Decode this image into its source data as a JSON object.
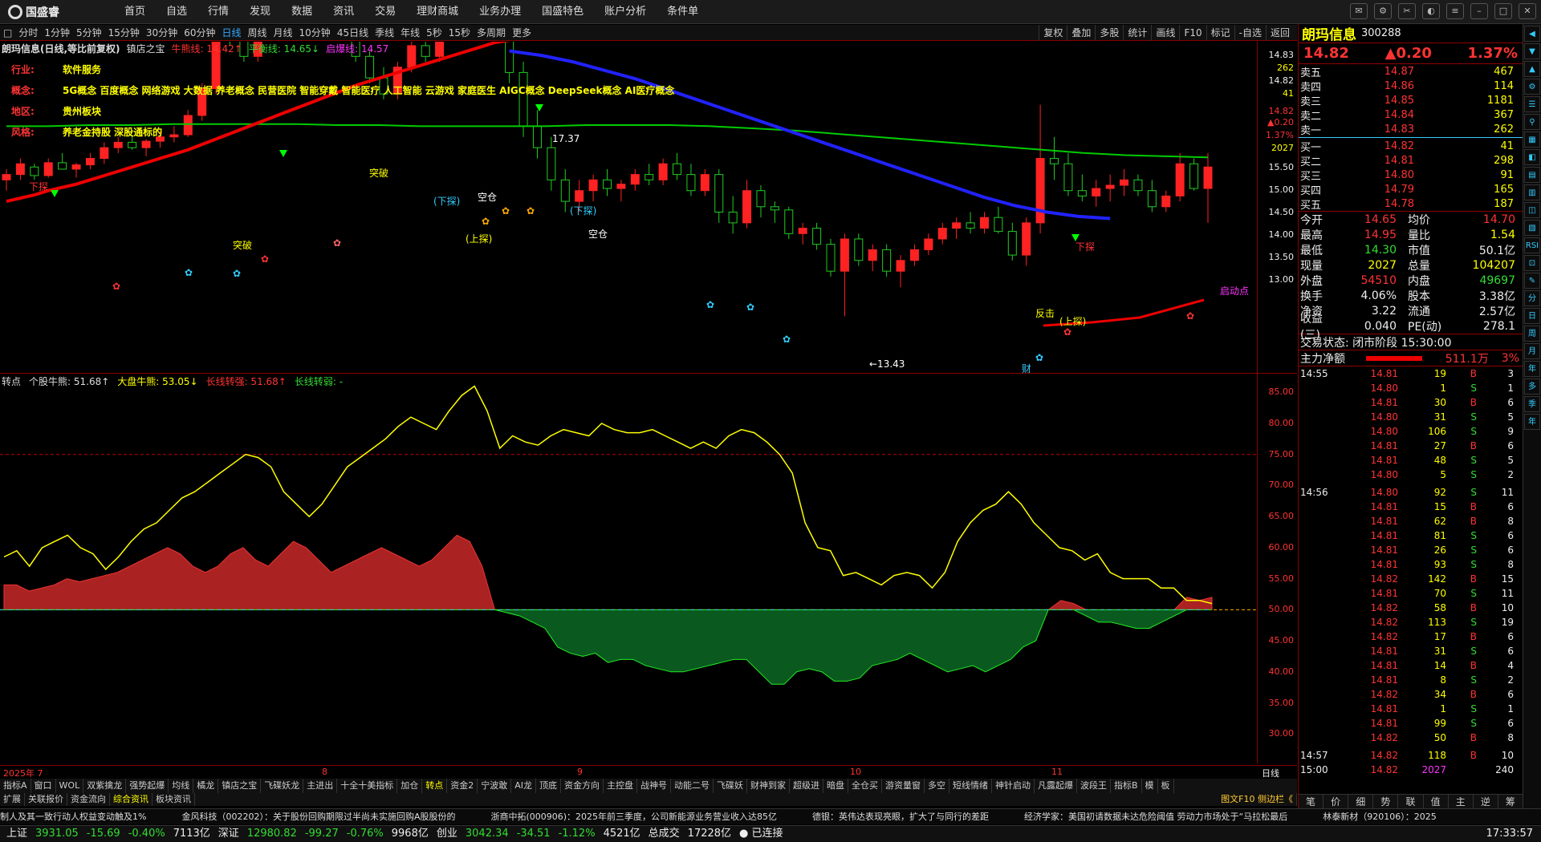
{
  "app": {
    "name": "国盛睿"
  },
  "menu": [
    "首页",
    "自选",
    "行情",
    "发现",
    "数据",
    "资讯",
    "交易",
    "理财商城",
    "业务办理",
    "国盛特色",
    "账户分析",
    "条件单"
  ],
  "periods": [
    "分时",
    "1分钟",
    "5分钟",
    "15分钟",
    "30分钟",
    "60分钟",
    "日线",
    "周线",
    "月线",
    "10分钟",
    "45日线",
    "季线",
    "年线",
    "5秒",
    "15秒",
    "多周期",
    "更多"
  ],
  "active_period": "日线",
  "chart_tools": [
    "复权",
    "叠加",
    "多股",
    "统计",
    "画线",
    "F10",
    "标记",
    "-自选",
    "返回"
  ],
  "chart_title": {
    "name": "朗玛信息(日线,等比前复权)",
    "indicator": "镇店之宝",
    "niu": "牛熊线: 14.42↑",
    "ping": "平衡线: 14.65↓",
    "qi": "启爆线: 14.57"
  },
  "stock_info": [
    {
      "label": "行业:",
      "value": "软件服务"
    },
    {
      "label": "概念:",
      "value": "5G概念 百度概念 网络游戏 大数据 养老概念 民营医院 智能穿戴 智能医疗 人工智能 云游戏 家庭医生 AIGC概念 DeepSeek概念 AI医疗概念"
    },
    {
      "label": "地区:",
      "value": "贵州板块"
    },
    {
      "label": "风格:",
      "value": "养老金持股 深股通标的"
    }
  ],
  "main_annotations": {
    "xiatan": "下探",
    "shangtan": "(上探)",
    "xiatan2": "(下探)",
    "kongcang": "空仓",
    "tupo": "突破",
    "qidong": "启动点",
    "qidian": "起涨",
    "peak": "17.37",
    "low": "←13.43",
    "cai": "财",
    "sub_peak": "下探",
    "fx": "反击"
  },
  "price_axis": [
    "14.83",
    "262",
    "14.82",
    "41",
    "14.82",
    "▲0.20",
    "1.37%",
    "2027",
    "15.50",
    "15.00",
    "14.50",
    "14.00",
    "13.50",
    "13.00"
  ],
  "sub_title": {
    "name": "转点",
    "a": "个股牛熊: 51.68↑",
    "b": "大盘牛熊: 53.05↓",
    "c": "长线转强: 51.68↑",
    "d": "长线转弱: -"
  },
  "sub_axis": [
    "85.00",
    "80.00",
    "75.00",
    "70.00",
    "65.00",
    "60.00",
    "55.00",
    "50.00",
    "45.00",
    "40.00",
    "35.00",
    "30.00"
  ],
  "dates": [
    "2025年 7",
    "8",
    "9",
    "10",
    "11"
  ],
  "day_label": "日线",
  "tabs1": [
    "指标A",
    "窗口",
    "WOL",
    "双紫擒龙",
    "强势起爆",
    "均线",
    "橘龙",
    "镇店之宝",
    "飞碟妖龙",
    "主进出",
    "十全十美指标",
    "加仓",
    "转点",
    "资金2",
    "宁波敢",
    "AI龙",
    "顶底",
    "资金方向",
    "主控盘",
    "战神号",
    "动能二号",
    "飞碟妖",
    "财神到家",
    "超级进",
    "暗盘",
    "全仓买",
    "游资量窗",
    "多空",
    "短线情绪",
    "神针启动",
    "凡露起爆",
    "波段王",
    "指标B",
    "模",
    "板"
  ],
  "tabs1_active": "转点",
  "tabs2": [
    "扩展",
    "关联报价",
    "资金流向",
    "综合资讯",
    "板块资讯"
  ],
  "tabs2_right": "图文F10 侧边栏《",
  "news": [
    "制人及其一致行动人权益变动触及1%",
    "金风科技（002202）：关于股份回购期限过半尚未实施回购A股股份的",
    "浙商中拓(000906)：2025年前三季度，公司新能源业务营业收入达85亿",
    "德银：英伟达表现亮眼，扩大了与同行的差距",
    "经济学家：美国初请数据未达危险阈值 劳动力市场处于“马拉松最后",
    "林泰新材（920106）：2025"
  ],
  "status": {
    "sh_label": "上证",
    "sh": "3931.05",
    "sh_chg": "-15.69",
    "sh_pct": "-0.40%",
    "sh_amt": "7113亿",
    "sz_label": "深证",
    "sz": "12980.82",
    "sz_chg": "-99.27",
    "sz_pct": "-0.76%",
    "sz_amt": "9968亿",
    "cy_label": "创业",
    "cy": "3042.34",
    "cy_chg": "-34.51",
    "cy_pct": "-1.12%",
    "cy_amt": "4521亿",
    "total_label": "总成交",
    "total": "17228亿",
    "conn": "已连接",
    "time": "17:33:57"
  },
  "quote": {
    "name": "朗玛信息",
    "code": "300288",
    "price": "14.82",
    "change": "▲0.20",
    "pct": "1.37%",
    "asks": [
      [
        "卖五",
        "14.87",
        "467"
      ],
      [
        "卖四",
        "14.86",
        "114"
      ],
      [
        "卖三",
        "14.85",
        "1181"
      ],
      [
        "卖二",
        "14.84",
        "367"
      ],
      [
        "卖一",
        "14.83",
        "262"
      ]
    ],
    "bids": [
      [
        "买一",
        "14.82",
        "41"
      ],
      [
        "买二",
        "14.81",
        "298"
      ],
      [
        "买三",
        "14.80",
        "91"
      ],
      [
        "买四",
        "14.79",
        "165"
      ],
      [
        "买五",
        "14.78",
        "187"
      ]
    ],
    "stats": [
      [
        "今开",
        "14.65",
        "均价",
        "14.70"
      ],
      [
        "最高",
        "14.95",
        "量比",
        "1.54"
      ],
      [
        "最低",
        "14.30",
        "市值",
        "50.1亿"
      ],
      [
        "现量",
        "2027",
        "总量",
        "104207"
      ],
      [
        "外盘",
        "54510",
        "内盘",
        "49697"
      ],
      [
        "换手",
        "4.06%",
        "股本",
        "3.38亿"
      ],
      [
        "净资",
        "3.22",
        "流通",
        "2.57亿"
      ],
      [
        "收益(三)",
        "0.040",
        "PE(动)",
        "278.1"
      ]
    ],
    "trade_status": "交易状态: 闭市阶段 15:30:00",
    "net_label": "主力净额",
    "net": "511.1万",
    "net_pct": "3%",
    "ticks": [
      [
        "14:55",
        "14.81",
        "19",
        "B",
        "3"
      ],
      [
        "",
        "14.80",
        "1",
        "S",
        "1"
      ],
      [
        "",
        "14.81",
        "30",
        "B",
        "6"
      ],
      [
        "",
        "14.80",
        "31",
        "S",
        "5"
      ],
      [
        "",
        "14.80",
        "106",
        "S",
        "9"
      ],
      [
        "",
        "14.81",
        "27",
        "B",
        "6"
      ],
      [
        "",
        "14.81",
        "48",
        "S",
        "5"
      ],
      [
        "",
        "14.80",
        "5",
        "S",
        "2"
      ],
      [
        "14:56",
        "14.80",
        "92",
        "S",
        "11"
      ],
      [
        "",
        "14.81",
        "15",
        "B",
        "6"
      ],
      [
        "",
        "14.81",
        "62",
        "B",
        "8"
      ],
      [
        "",
        "14.81",
        "81",
        "S",
        "6"
      ],
      [
        "",
        "14.81",
        "26",
        "S",
        "6"
      ],
      [
        "",
        "14.81",
        "93",
        "S",
        "8"
      ],
      [
        "",
        "14.82",
        "142",
        "B",
        "15"
      ],
      [
        "",
        "14.81",
        "70",
        "S",
        "11"
      ],
      [
        "",
        "14.82",
        "58",
        "B",
        "10"
      ],
      [
        "",
        "14.82",
        "113",
        "S",
        "19"
      ],
      [
        "",
        "14.82",
        "17",
        "B",
        "6"
      ],
      [
        "",
        "14.81",
        "31",
        "S",
        "6"
      ],
      [
        "",
        "14.81",
        "14",
        "B",
        "4"
      ],
      [
        "",
        "14.81",
        "8",
        "S",
        "2"
      ],
      [
        "",
        "14.82",
        "34",
        "B",
        "6"
      ],
      [
        "",
        "14.81",
        "1",
        "S",
        "1"
      ],
      [
        "",
        "14.81",
        "99",
        "S",
        "6"
      ],
      [
        "",
        "14.82",
        "50",
        "B",
        "8"
      ],
      [
        "14:57",
        "14.82",
        "118",
        "B",
        "10"
      ],
      [
        "15:00",
        "14.82",
        "2027",
        "",
        "240"
      ]
    ],
    "bottom_tabs": [
      "笔",
      "价",
      "细",
      "势",
      "联",
      "值",
      "主",
      "逆",
      "筹"
    ]
  },
  "vtabs": [
    "◀",
    "▼",
    "▲",
    "⚙",
    "☰",
    "⚲",
    "▦",
    "◧",
    "▤",
    "▥",
    "◫",
    "▧",
    "RSI",
    "⊡",
    "✎",
    "分",
    "日",
    "周",
    "月",
    "年",
    "多",
    "季",
    "年"
  ],
  "chart_data": {
    "type": "line",
    "title": "朗玛信息(日线,等比前复权)",
    "ylim_main": [
      13.0,
      15.8
    ],
    "candles": [
      [
        14.7,
        14.8,
        14.6,
        14.75
      ],
      [
        14.75,
        14.9,
        14.7,
        14.85
      ],
      [
        14.82,
        14.85,
        14.7,
        14.74
      ],
      [
        14.74,
        14.9,
        14.72,
        14.86
      ],
      [
        14.86,
        14.95,
        14.8,
        14.8
      ],
      [
        14.8,
        14.86,
        14.72,
        14.84
      ],
      [
        14.84,
        14.95,
        14.8,
        14.9
      ],
      [
        14.9,
        15.05,
        14.85,
        15.0
      ],
      [
        15.0,
        15.1,
        14.95,
        15.05
      ],
      [
        15.05,
        15.12,
        14.98,
        15.0
      ],
      [
        15.0,
        15.08,
        14.92,
        15.06
      ],
      [
        15.06,
        15.15,
        15.0,
        15.1
      ],
      [
        15.1,
        15.2,
        15.05,
        15.12
      ],
      [
        15.12,
        15.35,
        15.1,
        15.3
      ],
      [
        15.3,
        15.6,
        15.25,
        15.55
      ],
      [
        15.55,
        16.3,
        15.5,
        16.2
      ],
      [
        16.2,
        16.3,
        15.95,
        16.0
      ],
      [
        16.0,
        16.05,
        15.8,
        15.85
      ],
      [
        15.85,
        16.1,
        15.8,
        16.05
      ],
      [
        16.05,
        16.4,
        16.0,
        16.3
      ],
      [
        16.3,
        16.5,
        16.2,
        16.4
      ],
      [
        16.4,
        16.55,
        16.3,
        16.35
      ],
      [
        16.35,
        16.6,
        16.3,
        16.5
      ],
      [
        16.5,
        16.55,
        16.2,
        16.25
      ],
      [
        16.25,
        16.3,
        16.0,
        16.1
      ],
      [
        16.1,
        16.2,
        15.8,
        15.85
      ],
      [
        15.85,
        15.9,
        15.6,
        15.65
      ],
      [
        15.65,
        15.75,
        15.45,
        15.5
      ],
      [
        15.5,
        15.8,
        15.45,
        15.75
      ],
      [
        15.75,
        16.0,
        15.7,
        15.95
      ],
      [
        15.95,
        16.1,
        15.8,
        15.85
      ],
      [
        15.85,
        16.2,
        15.8,
        16.1
      ],
      [
        16.1,
        16.3,
        16.0,
        16.25
      ],
      [
        16.25,
        16.6,
        16.2,
        16.5
      ],
      [
        16.5,
        17.37,
        16.45,
        17.2
      ],
      [
        17.2,
        17.3,
        16.4,
        16.5
      ],
      [
        16.5,
        16.55,
        15.6,
        15.7
      ],
      [
        15.7,
        15.8,
        15.1,
        15.2
      ],
      [
        15.2,
        15.35,
        14.9,
        15.0
      ],
      [
        15.0,
        15.1,
        14.6,
        14.7
      ],
      [
        14.7,
        14.8,
        14.4,
        14.5
      ],
      [
        14.5,
        14.7,
        14.4,
        14.6
      ],
      [
        14.6,
        14.75,
        14.5,
        14.7
      ],
      [
        14.7,
        14.8,
        14.55,
        14.62
      ],
      [
        14.62,
        14.7,
        14.5,
        14.66
      ],
      [
        14.66,
        14.8,
        14.6,
        14.75
      ],
      [
        14.75,
        14.85,
        14.65,
        14.7
      ],
      [
        14.7,
        14.9,
        14.65,
        14.85
      ],
      [
        14.85,
        14.95,
        14.7,
        14.75
      ],
      [
        14.75,
        14.85,
        14.55,
        14.6
      ],
      [
        14.6,
        14.8,
        14.55,
        14.75
      ],
      [
        14.75,
        14.8,
        14.3,
        14.4
      ],
      [
        14.4,
        14.55,
        14.2,
        14.3
      ],
      [
        14.3,
        14.7,
        14.25,
        14.6
      ],
      [
        14.6,
        14.65,
        14.35,
        14.45
      ],
      [
        14.45,
        14.5,
        14.3,
        14.42
      ],
      [
        14.42,
        14.45,
        14.15,
        14.2
      ],
      [
        14.2,
        14.3,
        14.1,
        14.25
      ],
      [
        14.25,
        14.3,
        14.05,
        14.1
      ],
      [
        14.1,
        14.15,
        13.8,
        13.85
      ],
      [
        13.85,
        14.2,
        13.43,
        14.15
      ],
      [
        14.15,
        14.2,
        13.9,
        13.95
      ],
      [
        13.95,
        14.1,
        13.85,
        14.05
      ],
      [
        14.05,
        14.1,
        13.8,
        13.85
      ],
      [
        13.85,
        14.0,
        13.7,
        13.95
      ],
      [
        13.95,
        14.1,
        13.9,
        14.05
      ],
      [
        14.05,
        14.2,
        14.0,
        14.15
      ],
      [
        14.15,
        14.3,
        14.1,
        14.25
      ],
      [
        14.25,
        14.35,
        14.15,
        14.3
      ],
      [
        14.3,
        14.4,
        14.2,
        14.25
      ],
      [
        14.25,
        14.4,
        14.2,
        14.35
      ],
      [
        14.35,
        14.45,
        14.2,
        14.22
      ],
      [
        14.22,
        14.3,
        13.95,
        14.0
      ],
      [
        14.0,
        14.35,
        13.9,
        14.3
      ],
      [
        14.3,
        15.4,
        14.2,
        14.9
      ],
      [
        14.9,
        15.1,
        14.7,
        14.85
      ],
      [
        14.85,
        14.95,
        14.55,
        14.6
      ],
      [
        14.6,
        14.75,
        14.5,
        14.55
      ],
      [
        14.55,
        14.7,
        14.45,
        14.62
      ],
      [
        14.62,
        14.75,
        14.5,
        14.65
      ],
      [
        14.65,
        14.8,
        14.55,
        14.7
      ],
      [
        14.7,
        14.75,
        14.55,
        14.6
      ],
      [
        14.6,
        14.7,
        14.4,
        14.45
      ],
      [
        14.45,
        14.6,
        14.4,
        14.55
      ],
      [
        14.55,
        14.95,
        14.5,
        14.85
      ],
      [
        14.85,
        14.9,
        14.6,
        14.62
      ],
      [
        14.62,
        14.95,
        14.3,
        14.82
      ]
    ],
    "series": [
      {
        "name": "牛熊线",
        "values": [
          14.5,
          14.53,
          14.56,
          14.6,
          14.63,
          14.66,
          14.7,
          14.74,
          14.78,
          14.82,
          14.86,
          14.9,
          14.94,
          14.98,
          15.03,
          15.08,
          15.13,
          15.18,
          15.23,
          15.28,
          15.33,
          15.38,
          15.43,
          15.48,
          15.53,
          15.58,
          15.62,
          15.66,
          15.7,
          15.74,
          15.78,
          15.82,
          15.86,
          15.9,
          15.94,
          15.98,
          16.0
        ]
      },
      {
        "name": "平衡线",
        "values": [
          15.2,
          15.2,
          15.21,
          15.21,
          15.22,
          15.22,
          15.22,
          15.22,
          15.21,
          15.21,
          15.2,
          15.2,
          15.2,
          15.2,
          15.21,
          15.21,
          15.21,
          15.2,
          15.18,
          15.16,
          15.13,
          15.1,
          15.07,
          15.04,
          15.01,
          14.98,
          14.95,
          14.93,
          14.92,
          14.91
        ]
      },
      {
        "name": "启爆线",
        "values": [
          15.9,
          15.86,
          15.8,
          15.72,
          15.64,
          15.54,
          15.44,
          15.34,
          15.24,
          15.14,
          15.04,
          14.94,
          14.84,
          14.74,
          14.64,
          14.54,
          14.46,
          14.4,
          14.36,
          14.34
        ]
      }
    ],
    "sub_ylim": [
      25,
      88
    ],
    "sub_series": [
      {
        "name": "个股牛熊",
        "values": [
          58.5,
          59.5,
          57,
          60,
          61,
          62,
          60,
          59,
          56.5,
          58.5,
          61,
          63,
          64,
          66,
          68,
          69,
          70.5,
          72,
          73.5,
          75,
          74.5,
          73,
          69,
          67,
          65,
          67,
          70,
          73,
          74.5,
          76,
          77.5,
          79.5,
          81,
          80,
          79,
          82,
          84.5,
          86,
          82,
          76,
          78,
          77,
          76.5,
          78,
          79,
          78.5,
          78,
          80,
          79,
          78.5,
          78.5,
          79,
          78,
          77,
          76,
          77,
          76,
          78,
          79,
          78.5,
          77,
          75,
          72,
          64,
          60,
          59.5,
          55.5,
          56,
          55,
          54,
          55.5,
          56,
          55.5,
          53.5,
          56,
          61,
          64,
          66,
          67,
          69,
          67,
          64,
          62,
          60,
          59.5,
          58,
          59,
          56,
          55,
          55,
          55,
          53.5,
          53.5,
          51.5,
          51.5,
          51
        ]
      },
      {
        "name": "大盘牛熊",
        "values": [
          54,
          54,
          53,
          53.5,
          54,
          55,
          54.5,
          55,
          55.5,
          56,
          57,
          58,
          59,
          60,
          59,
          57,
          56,
          57,
          59,
          60,
          58,
          57,
          59,
          61,
          60,
          58,
          56,
          57,
          58,
          59,
          60,
          59,
          58,
          57,
          58,
          60,
          62,
          61,
          57,
          50,
          49.5,
          49,
          48,
          47,
          44,
          43,
          42.5,
          43,
          41.5,
          42,
          42,
          41,
          40.5,
          40,
          40,
          40.5,
          41,
          41.5,
          42,
          42,
          40,
          38,
          38,
          40,
          40.5,
          40,
          38.5,
          38.5,
          39,
          41,
          41.5,
          42,
          43,
          42,
          41,
          40,
          40.5,
          41,
          40,
          41,
          42,
          44,
          45,
          50,
          51.5,
          51,
          49,
          48,
          48,
          47.5,
          47,
          47,
          48,
          49,
          52,
          51.5,
          52
        ]
      }
    ],
    "sub_levels": [
      75,
      50
    ]
  }
}
